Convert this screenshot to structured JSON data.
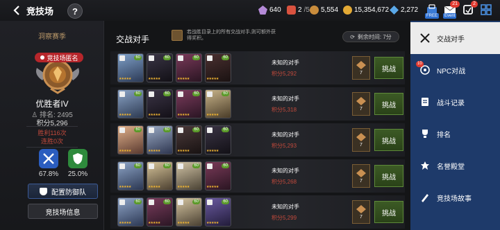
{
  "header": {
    "title": "竞技场",
    "help": "?",
    "resources": [
      {
        "icon": "crystal-icon",
        "value": "640",
        "color": "#b48ad8"
      },
      {
        "icon": "ticket-icon",
        "value": "2",
        "suffix": "/5",
        "color": "#d9523f"
      },
      {
        "icon": "medal-icon",
        "value": "5,554",
        "color": "#c98c3c"
      },
      {
        "icon": "gold-icon",
        "value": "15,354,672",
        "color": "#e3a935"
      },
      {
        "icon": "gem-icon",
        "value": "2,272",
        "color": "#5aa8e8"
      }
    ],
    "icons": [
      {
        "name": "shop-free-icon",
        "tag": "FREE",
        "badge": ""
      },
      {
        "name": "mail-icon",
        "tag": "Event",
        "badge": "21"
      },
      {
        "name": "mission-icon",
        "tag": "",
        "badge": "2"
      },
      {
        "name": "menu-grid-icon",
        "tag": "",
        "badge": ""
      }
    ]
  },
  "left": {
    "season": "洞察赛季",
    "rank_pill": "竞技场匿名",
    "tier": "优胜者IV",
    "rank_label": "排名:",
    "rank_value": "2495",
    "score": "积分5,296",
    "wins": "胜利116次",
    "streak": "连胜0次",
    "attack_pct": "67.8%",
    "defense_pct": "25.0%",
    "btn_defense": "配置防御队",
    "btn_info": "竞技场信息"
  },
  "main": {
    "heading": "交战对手",
    "hint": "若战胜目录上的所有交战对手,则可额外获得奖积。",
    "timer": "剩余时间: 7分",
    "opponents": [
      {
        "name": "未知的对手",
        "score": "积分5,292",
        "rank": "7",
        "fight": "挑战",
        "levels": [
          "60",
          "60",
          "60",
          "60"
        ]
      },
      {
        "name": "未知的对手",
        "score": "积分5,318",
        "rank": "7",
        "fight": "挑战",
        "levels": [
          "60",
          "60",
          "60",
          "60"
        ]
      },
      {
        "name": "未知的对手",
        "score": "积分5,293",
        "rank": "7",
        "fight": "挑战",
        "levels": [
          "60",
          "60",
          "60",
          "60"
        ]
      },
      {
        "name": "未知的对手",
        "score": "积分5,268",
        "rank": "7",
        "fight": "挑战",
        "levels": [
          "60",
          "60",
          "60",
          "60"
        ]
      },
      {
        "name": "未知的对手",
        "score": "积分5,299",
        "rank": "7",
        "fight": "挑战",
        "levels": [
          "60",
          "60",
          "60",
          "60"
        ]
      }
    ]
  },
  "menu": {
    "items": [
      {
        "label": "交战对手",
        "icon": "swords-icon",
        "badge": ""
      },
      {
        "label": "NPC对战",
        "icon": "npc-icon",
        "badge": "10"
      },
      {
        "label": "战斗记录",
        "icon": "record-icon",
        "badge": ""
      },
      {
        "label": "排名",
        "icon": "trophy-icon",
        "badge": ""
      },
      {
        "label": "名誉殿堂",
        "icon": "hall-icon",
        "badge": ""
      },
      {
        "label": "竞技场故事",
        "icon": "story-icon",
        "badge": ""
      }
    ]
  }
}
